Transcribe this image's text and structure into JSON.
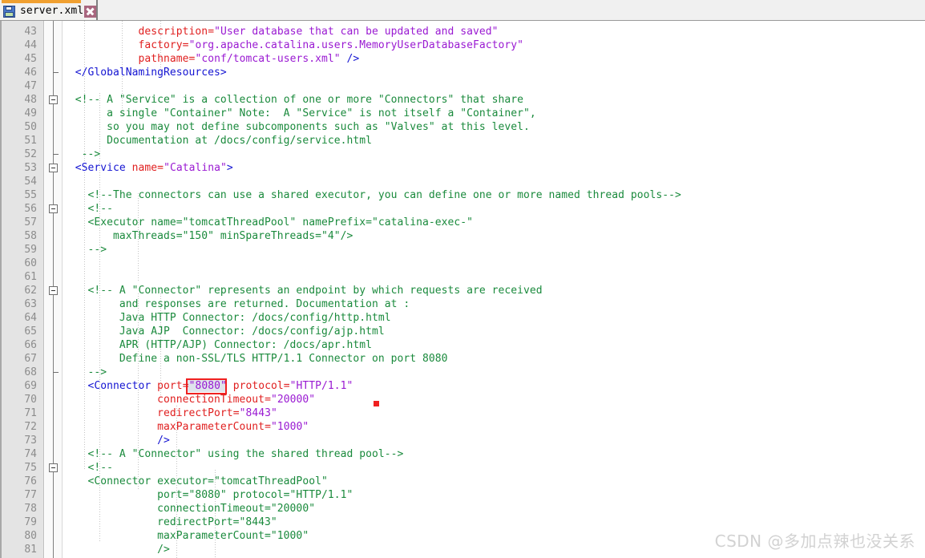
{
  "window": {
    "title": "server.xml"
  },
  "tab": {
    "label": "server.xml",
    "save_icon": "floppy-disk-icon",
    "close_icon": "close-icon",
    "accent_color": "#f0a030",
    "close_bg_color": "#a8667e",
    "modified": true
  },
  "editor": {
    "language": "xml",
    "first_visible_line": 43,
    "last_visible_line": 81,
    "line_height_px": 17,
    "colors": {
      "tag": "#1414d2",
      "attribute": "#e02020",
      "value": "#9a1ad2",
      "comment": "#1a8a3c",
      "gutter_bg": "#e4e4e4",
      "line_number": "#8c8c8c",
      "selection_bg": "#dfe4ec",
      "annotation_red": "#f02020"
    },
    "fold_markers": [
      48,
      53,
      56,
      62,
      75
    ],
    "fold_end_markers": [
      46,
      52,
      68
    ],
    "lines": [
      {
        "n": 43,
        "segs": [
          {
            "t": "            ",
            "c": "plain"
          },
          {
            "t": "description",
            "c": "attr"
          },
          {
            "t": "=",
            "c": "attr"
          },
          {
            "t": "\"User database that can be updated and saved\"",
            "c": "val"
          }
        ]
      },
      {
        "n": 44,
        "segs": [
          {
            "t": "            ",
            "c": "plain"
          },
          {
            "t": "factory",
            "c": "attr"
          },
          {
            "t": "=",
            "c": "attr"
          },
          {
            "t": "\"org.apache.catalina.users.MemoryUserDatabaseFactory\"",
            "c": "val"
          }
        ]
      },
      {
        "n": 45,
        "segs": [
          {
            "t": "            ",
            "c": "plain"
          },
          {
            "t": "pathname",
            "c": "attr"
          },
          {
            "t": "=",
            "c": "attr"
          },
          {
            "t": "\"conf/tomcat-users.xml\"",
            "c": "val"
          },
          {
            "t": " ",
            "c": "plain"
          },
          {
            "t": "/>",
            "c": "tag"
          }
        ]
      },
      {
        "n": 46,
        "segs": [
          {
            "t": "  ",
            "c": "plain"
          },
          {
            "t": "</GlobalNamingResources>",
            "c": "tag"
          }
        ]
      },
      {
        "n": 47,
        "segs": []
      },
      {
        "n": 48,
        "segs": [
          {
            "t": "  ",
            "c": "plain"
          },
          {
            "t": "<!-- A \"Service\" is a collection of one or more \"Connectors\" that share",
            "c": "cmt"
          }
        ]
      },
      {
        "n": 49,
        "segs": [
          {
            "t": "       a single \"Container\" Note:  A \"Service\" is not itself a \"Container\",",
            "c": "cmt"
          }
        ]
      },
      {
        "n": 50,
        "segs": [
          {
            "t": "       so you may not define subcomponents such as \"Valves\" at this level.",
            "c": "cmt"
          }
        ]
      },
      {
        "n": 51,
        "segs": [
          {
            "t": "       Documentation at /docs/config/service.html",
            "c": "cmt"
          }
        ]
      },
      {
        "n": 52,
        "segs": [
          {
            "t": "   -->",
            "c": "cmt"
          }
        ]
      },
      {
        "n": 53,
        "segs": [
          {
            "t": "  ",
            "c": "plain"
          },
          {
            "t": "<Service ",
            "c": "tag"
          },
          {
            "t": "name",
            "c": "attr"
          },
          {
            "t": "=",
            "c": "attr"
          },
          {
            "t": "\"Catalina\"",
            "c": "val"
          },
          {
            "t": ">",
            "c": "tag"
          }
        ]
      },
      {
        "n": 54,
        "segs": []
      },
      {
        "n": 55,
        "segs": [
          {
            "t": "    <!--The connectors can use a shared executor, you can define one or more named thread pools-->",
            "c": "cmt"
          }
        ]
      },
      {
        "n": 56,
        "segs": [
          {
            "t": "    <!--",
            "c": "cmt"
          }
        ]
      },
      {
        "n": 57,
        "segs": [
          {
            "t": "    <Executor name=\"tomcatThreadPool\" namePrefix=\"catalina-exec-\"",
            "c": "cmt"
          }
        ]
      },
      {
        "n": 58,
        "segs": [
          {
            "t": "        maxThreads=\"150\" minSpareThreads=\"4\"/>",
            "c": "cmt"
          }
        ]
      },
      {
        "n": 59,
        "segs": [
          {
            "t": "    -->",
            "c": "cmt"
          }
        ]
      },
      {
        "n": 60,
        "segs": []
      },
      {
        "n": 61,
        "segs": []
      },
      {
        "n": 62,
        "segs": [
          {
            "t": "    <!-- A \"Connector\" represents an endpoint by which requests are received",
            "c": "cmt"
          }
        ]
      },
      {
        "n": 63,
        "segs": [
          {
            "t": "         and responses are returned. Documentation at :",
            "c": "cmt"
          }
        ]
      },
      {
        "n": 64,
        "segs": [
          {
            "t": "         Java HTTP Connector: /docs/config/http.html",
            "c": "cmt"
          }
        ]
      },
      {
        "n": 65,
        "segs": [
          {
            "t": "         Java AJP  Connector: /docs/config/ajp.html",
            "c": "cmt"
          }
        ]
      },
      {
        "n": 66,
        "segs": [
          {
            "t": "         APR (HTTP/AJP) Connector: /docs/apr.html",
            "c": "cmt"
          }
        ]
      },
      {
        "n": 67,
        "segs": [
          {
            "t": "         Define a non-SSL/TLS HTTP/1.1 Connector on port 8080",
            "c": "cmt"
          }
        ]
      },
      {
        "n": 68,
        "segs": [
          {
            "t": "    -->",
            "c": "cmt"
          }
        ]
      },
      {
        "n": 69,
        "segs": [
          {
            "t": "    ",
            "c": "plain"
          },
          {
            "t": "<Connector ",
            "c": "tag"
          },
          {
            "t": "port",
            "c": "attr"
          },
          {
            "t": "=",
            "c": "attr"
          },
          {
            "t": "\"8080\"",
            "c": "val"
          },
          {
            "t": " ",
            "c": "plain"
          },
          {
            "t": "protocol",
            "c": "attr"
          },
          {
            "t": "=",
            "c": "attr"
          },
          {
            "t": "\"HTTP/1.1\"",
            "c": "val"
          }
        ]
      },
      {
        "n": 70,
        "segs": [
          {
            "t": "               ",
            "c": "plain"
          },
          {
            "t": "connectionTimeout",
            "c": "attr"
          },
          {
            "t": "=",
            "c": "attr"
          },
          {
            "t": "\"20000\"",
            "c": "val"
          }
        ]
      },
      {
        "n": 71,
        "segs": [
          {
            "t": "               ",
            "c": "plain"
          },
          {
            "t": "redirectPort",
            "c": "attr"
          },
          {
            "t": "=",
            "c": "attr"
          },
          {
            "t": "\"8443\"",
            "c": "val"
          }
        ]
      },
      {
        "n": 72,
        "segs": [
          {
            "t": "               ",
            "c": "plain"
          },
          {
            "t": "maxParameterCount",
            "c": "attr"
          },
          {
            "t": "=",
            "c": "attr"
          },
          {
            "t": "\"1000\"",
            "c": "val"
          }
        ]
      },
      {
        "n": 73,
        "segs": [
          {
            "t": "               ",
            "c": "plain"
          },
          {
            "t": "/>",
            "c": "tag"
          }
        ]
      },
      {
        "n": 74,
        "segs": [
          {
            "t": "    <!-- A \"Connector\" using the shared thread pool-->",
            "c": "cmt"
          }
        ]
      },
      {
        "n": 75,
        "segs": [
          {
            "t": "    <!--",
            "c": "cmt"
          }
        ]
      },
      {
        "n": 76,
        "segs": [
          {
            "t": "    <Connector executor=\"tomcatThreadPool\"",
            "c": "cmt"
          }
        ]
      },
      {
        "n": 77,
        "segs": [
          {
            "t": "               port=\"8080\" protocol=\"HTTP/1.1\"",
            "c": "cmt"
          }
        ]
      },
      {
        "n": 78,
        "segs": [
          {
            "t": "               connectionTimeout=\"20000\"",
            "c": "cmt"
          }
        ]
      },
      {
        "n": 79,
        "segs": [
          {
            "t": "               redirectPort=\"8443\"",
            "c": "cmt"
          }
        ]
      },
      {
        "n": 80,
        "segs": [
          {
            "t": "               maxParameterCount=\"1000\"",
            "c": "cmt"
          }
        ]
      },
      {
        "n": 81,
        "segs": [
          {
            "t": "               />",
            "c": "cmt"
          }
        ]
      }
    ]
  },
  "annotation": {
    "highlighted_text": "\"8080\"",
    "highlighted_line": 69,
    "box_color": "#f02020",
    "marker_dot": true
  },
  "watermark": {
    "text": "CSDN @多加点辣也没关系"
  }
}
